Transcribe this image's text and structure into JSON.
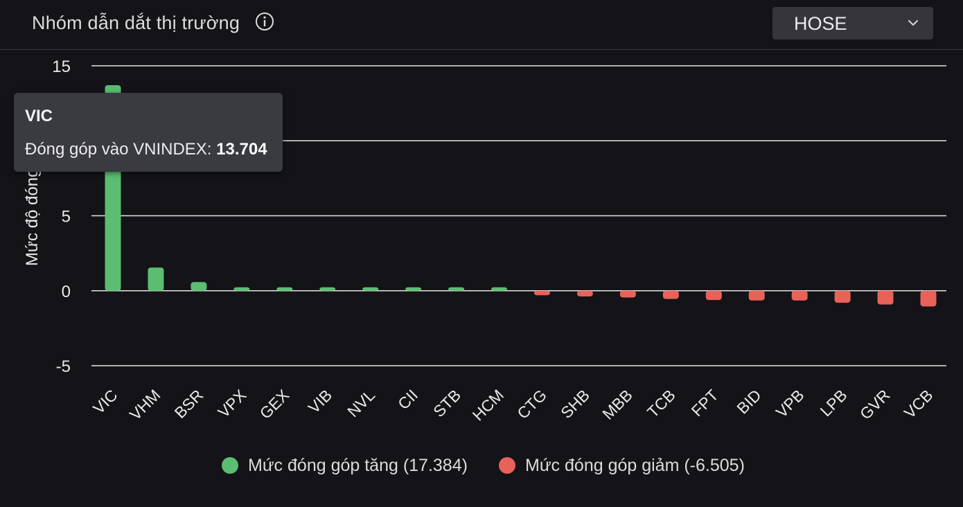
{
  "header": {
    "title": "Nhóm dẫn dắt thị trường",
    "info_icon": "info-icon",
    "exchange_select": {
      "value": "HOSE",
      "icon": "chevron-down-icon"
    }
  },
  "tooltip": {
    "title": "VIC",
    "label": "Đóng góp vào VNINDEX: ",
    "value": "13.704"
  },
  "legend": {
    "increase_label": "Mức đóng góp tăng (17.384)",
    "decrease_label": "Mức đóng góp giảm (-6.505)"
  },
  "colors": {
    "increase": "#5bbd72",
    "decrease": "#e8625a",
    "grid": "#e6e6e6",
    "text": "#e9e9ea",
    "background": "#141317"
  },
  "chart_data": {
    "type": "bar",
    "title": "",
    "xlabel": "",
    "ylabel": "Mức độ đóng góp",
    "ylim": [
      -5,
      15
    ],
    "yticks": [
      15,
      10,
      5,
      0,
      -5
    ],
    "grid": true,
    "legend_position": "bottom",
    "categories": [
      "VIC",
      "VHM",
      "BSR",
      "VPX",
      "GEX",
      "VIB",
      "NVL",
      "CII",
      "STB",
      "HCM",
      "CTG",
      "SHB",
      "MBB",
      "TCB",
      "FPT",
      "BID",
      "VPB",
      "LPB",
      "GVR",
      "VCB"
    ],
    "values": [
      13.704,
      1.55,
      0.58,
      0.22,
      0.2,
      0.2,
      0.13,
      0.13,
      0.12,
      0.12,
      -0.3,
      -0.38,
      -0.45,
      -0.55,
      -0.62,
      -0.65,
      -0.65,
      -0.8,
      -0.92,
      -1.05
    ]
  }
}
